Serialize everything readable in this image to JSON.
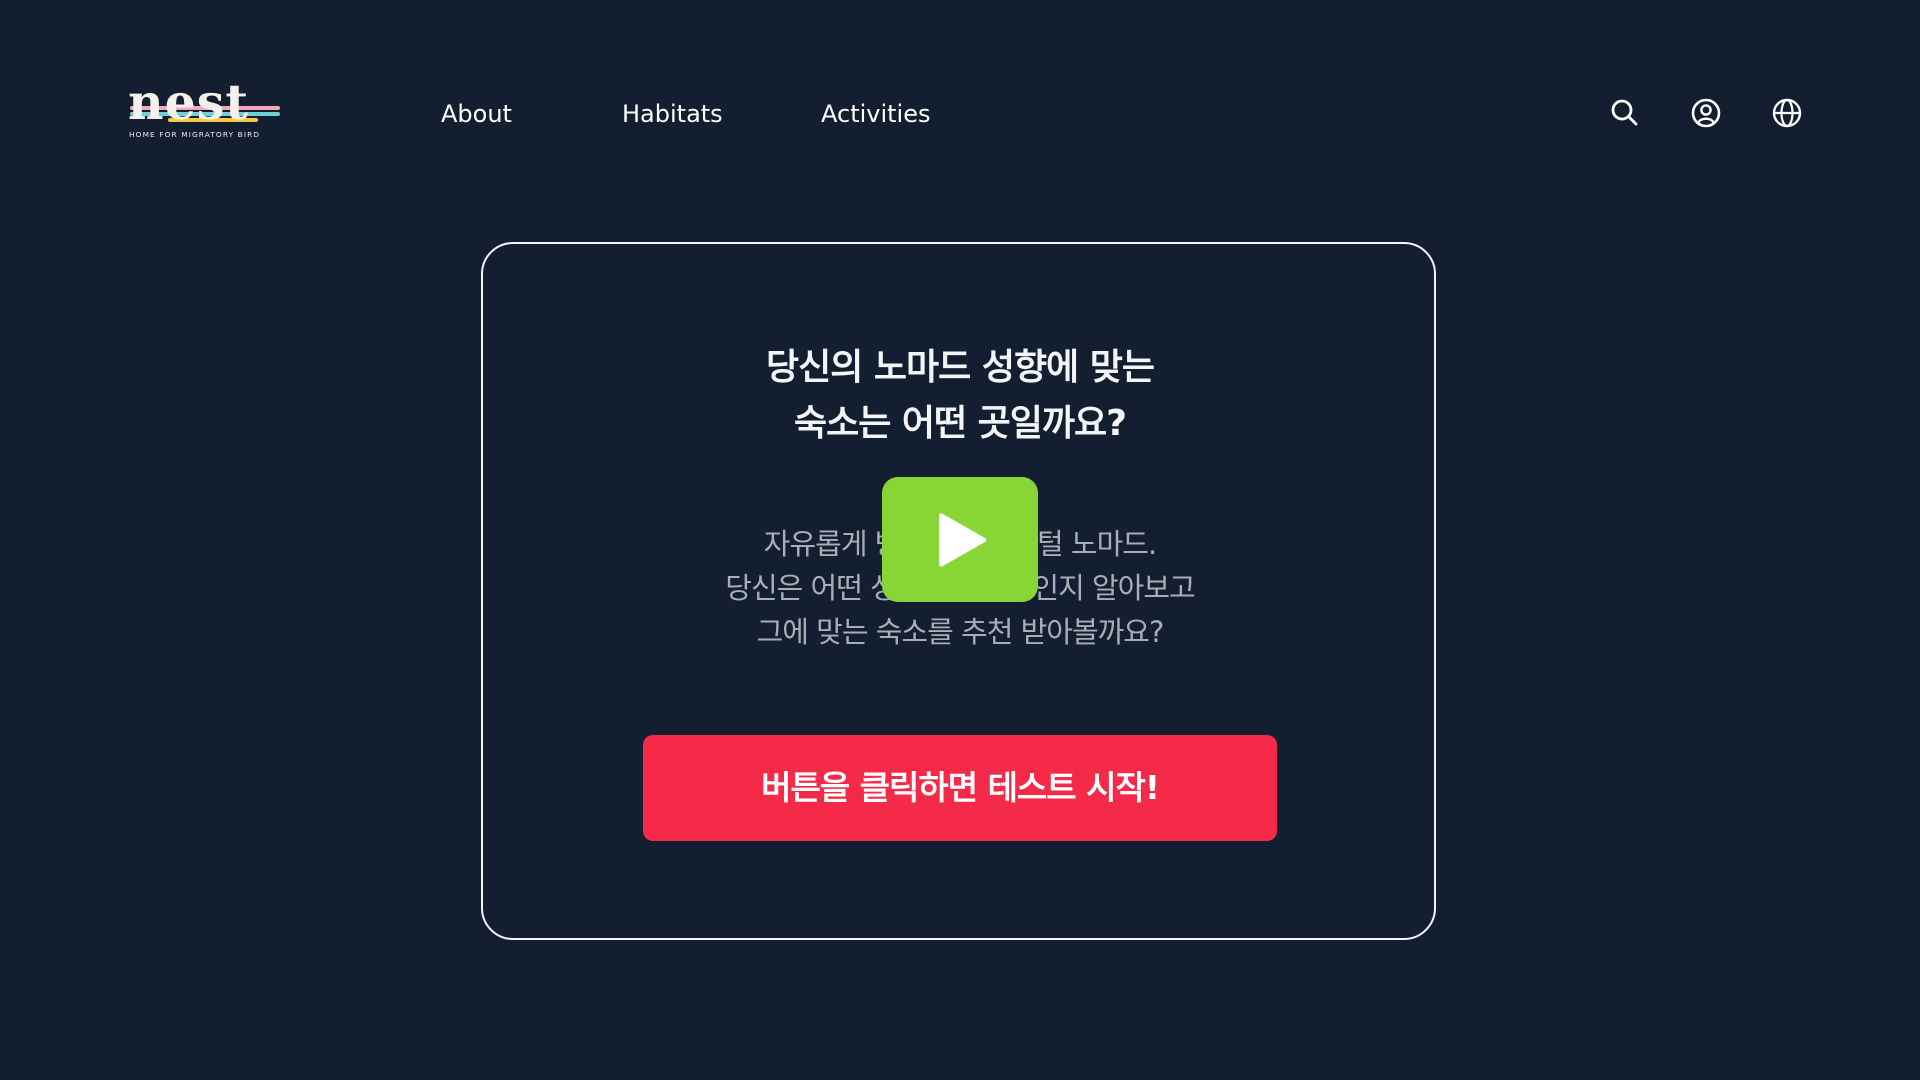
{
  "brand": {
    "name": "nest",
    "tagline": "HOME FOR MIGRATORY BIRD",
    "stripe_colors": [
      "#f4a7b9",
      "#6fd0d8",
      "#f6c945"
    ]
  },
  "nav": {
    "items": [
      {
        "label": "About"
      },
      {
        "label": "Habitats"
      },
      {
        "label": "Activities"
      }
    ]
  },
  "header_icons": [
    "search-icon",
    "user-account-icon",
    "globe-language-icon"
  ],
  "hero": {
    "headline_lines": [
      "당신의 노마드 성향에 맞는",
      "숙소는 어떤 곳일까요?"
    ],
    "description_lines": [
      "자유롭게 방랑하는 디지털 노마드.",
      "당신은 어떤 성향의 노마드인지 알아보고",
      "그에 맞는 숙소를 추천 받아볼까요?"
    ],
    "play_icon": "play-icon",
    "cta_label": "버튼을 클릭하면 테스트 시작!"
  },
  "colors": {
    "background": "#131e31",
    "play_button": "#87d635",
    "cta_button": "#f42a48",
    "card_border": "#f2f4f7",
    "description_text": "#a8adb6"
  }
}
